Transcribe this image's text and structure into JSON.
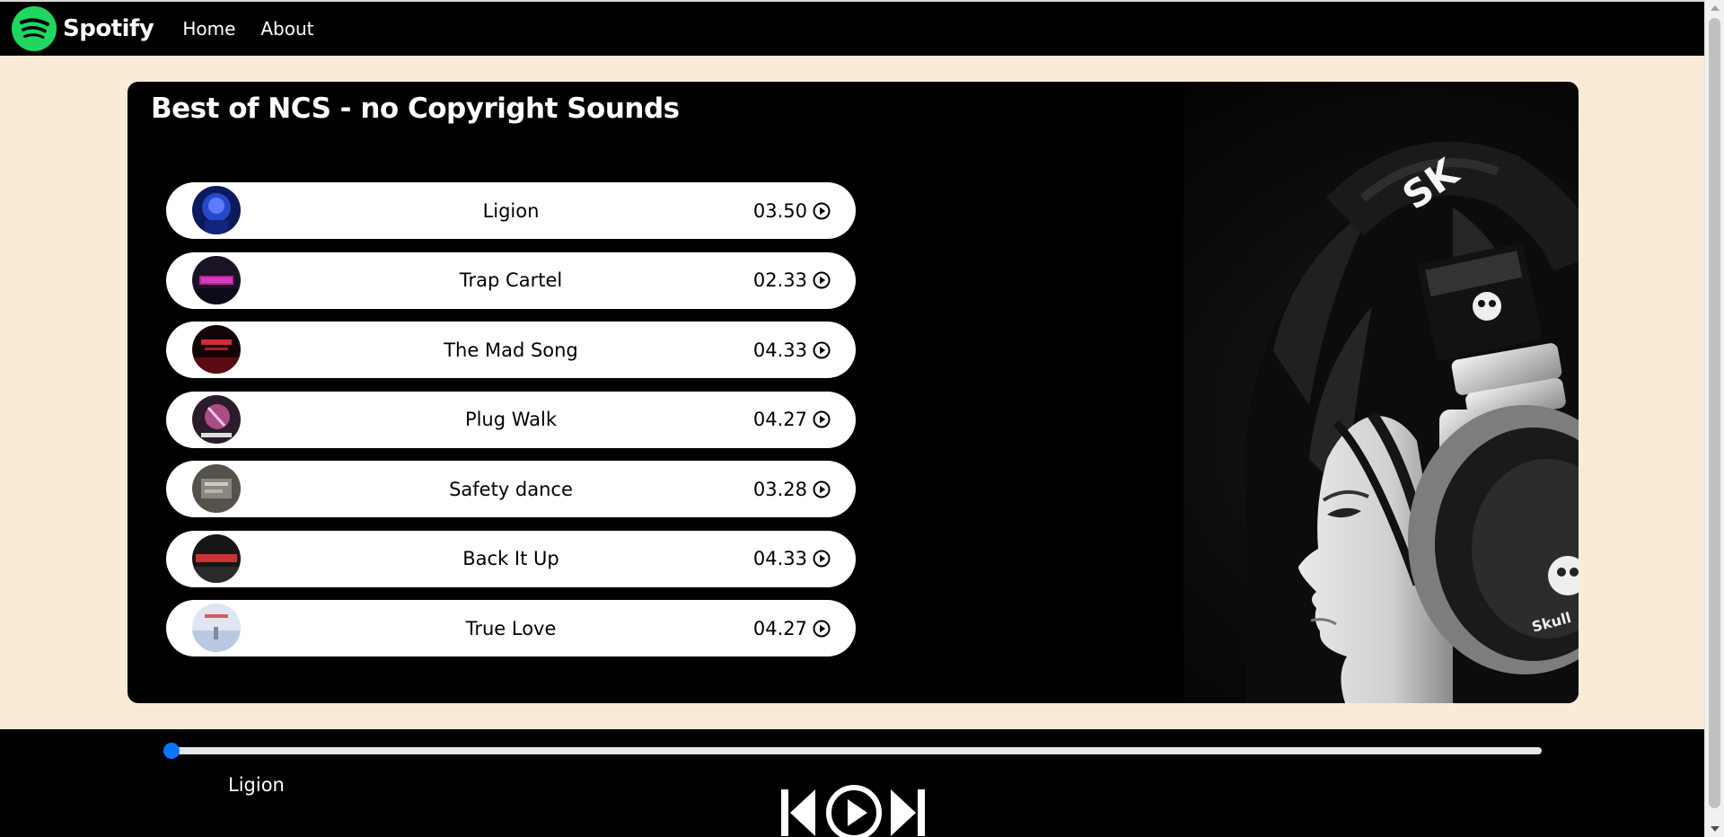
{
  "nav": {
    "brand": "Spotify",
    "links": [
      "Home",
      "About"
    ],
    "logo_icon": "spotify-logo-icon",
    "brand_color": "#1ed760"
  },
  "playlist": {
    "title": "Best of NCS - no Copyright Sounds",
    "songs": [
      {
        "name": "Ligion",
        "duration": "03.50",
        "cover_color": "#1c2d8a"
      },
      {
        "name": "Trap Cartel",
        "duration": "02.33",
        "cover_color": "#3a1c55"
      },
      {
        "name": "The Mad Song",
        "duration": "04.33",
        "cover_color": "#5a0b12"
      },
      {
        "name": "Plug Walk",
        "duration": "04.27",
        "cover_color": "#5e3a5c"
      },
      {
        "name": "Safety dance",
        "duration": "03.28",
        "cover_color": "#6a6a66"
      },
      {
        "name": "Back It Up",
        "duration": "04.33",
        "cover_color": "#3b1a1a"
      },
      {
        "name": "True Love",
        "duration": "04.27",
        "cover_color": "#c7d4e8"
      }
    ]
  },
  "player": {
    "current_song": "Ligion",
    "progress_percent": 0,
    "accent_color": "#0a75ff",
    "controls": [
      "previous-icon",
      "play-circle-icon",
      "next-icon"
    ]
  }
}
